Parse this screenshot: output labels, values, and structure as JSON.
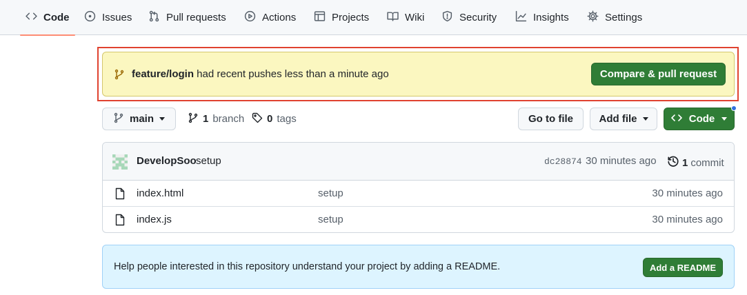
{
  "nav": {
    "tabs": [
      {
        "label": "Code",
        "icon": "code-icon",
        "active": true
      },
      {
        "label": "Issues",
        "icon": "issue-icon"
      },
      {
        "label": "Pull requests",
        "icon": "pull-request-icon"
      },
      {
        "label": "Actions",
        "icon": "play-icon"
      },
      {
        "label": "Projects",
        "icon": "table-icon"
      },
      {
        "label": "Wiki",
        "icon": "book-icon"
      },
      {
        "label": "Security",
        "icon": "shield-icon"
      },
      {
        "label": "Insights",
        "icon": "graph-icon"
      },
      {
        "label": "Settings",
        "icon": "gear-icon"
      }
    ]
  },
  "banner": {
    "branch": "feature/login",
    "message": " had recent pushes less than a minute ago",
    "button": "Compare & pull request"
  },
  "toolbar": {
    "branch_select": "main",
    "branch_count": "1",
    "branch_label": "branch",
    "tag_count": "0",
    "tag_label": "tags",
    "go_to_file": "Go to file",
    "add_file": "Add file",
    "code": "Code"
  },
  "commit": {
    "author": "DevelopSoo",
    "message": "setup",
    "hash": "dc28874",
    "time": "30 minutes ago",
    "count": "1",
    "count_label": "commit"
  },
  "files": [
    {
      "name": "index.html",
      "message": "setup",
      "time": "30 minutes ago"
    },
    {
      "name": "index.js",
      "message": "setup",
      "time": "30 minutes ago"
    }
  ],
  "readme": {
    "message": "Help people interested in this repository understand your project by adding a README.",
    "button": "Add a README"
  },
  "colors": {
    "primary_green": "#2f7d36",
    "banner_yellow": "#fbf7c0",
    "readme_blue": "#ddf4ff",
    "highlight_red": "#e0422f",
    "tab_underline": "#fd8c73"
  }
}
